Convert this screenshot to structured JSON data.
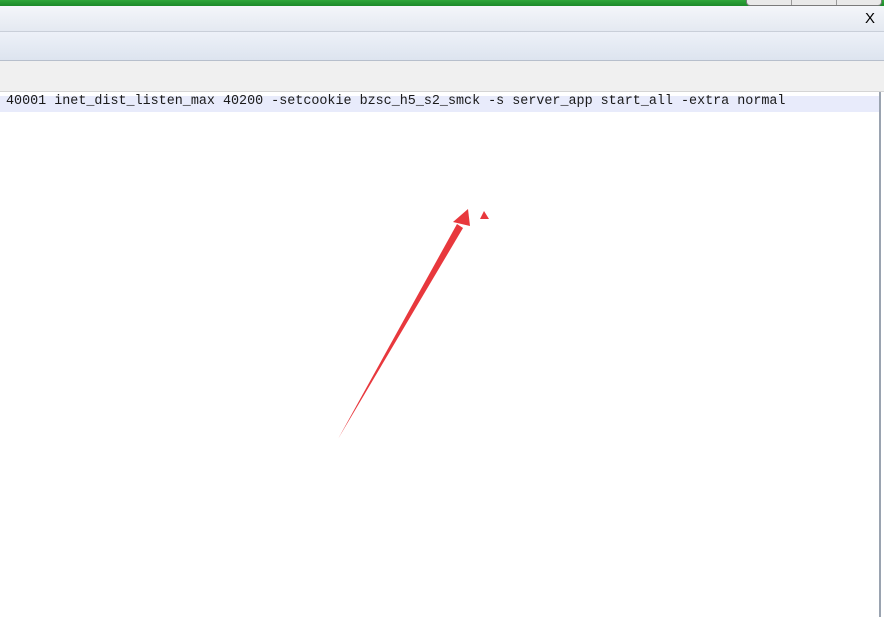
{
  "window": {
    "close_label": "X"
  },
  "editor": {
    "command_text": "40001 inet_dist_listen_max 40200 -setcookie bzsc_h5_s2_smck -s server_app start_all -extra normal"
  },
  "colors": {
    "titlebar": "#1c8a2a",
    "annotation": "#e8383d",
    "highlight_row": "#e8ebfb"
  }
}
